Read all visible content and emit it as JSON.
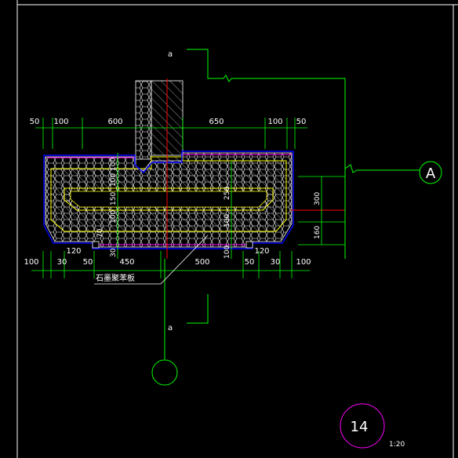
{
  "drawing": {
    "section_mark_top": "a",
    "section_mark_bottom": "a",
    "axis_label": "A",
    "detail_number": "14",
    "detail_scale": "1:20",
    "material_label": "石墨聚苯板",
    "colors": {
      "background": "#000000",
      "frame": "#ffffff",
      "dimension": "#00ff00",
      "concrete": "#ffff00",
      "insulation": "#0000ff",
      "hatch": "#ffffff",
      "axis": "#ff0000",
      "magenta": "#ff00ff",
      "leader": "#00ff00"
    }
  },
  "dims_top": [
    "50",
    "100",
    "600",
    "650",
    "100",
    "50"
  ],
  "dims_bottom": [
    "100",
    "30",
    "120",
    "50",
    "450",
    "500",
    "50",
    "120",
    "30",
    "100"
  ],
  "dims_vertical_left": [
    "100",
    "100",
    "150",
    "100",
    "70",
    "30"
  ],
  "dims_vertical_center": [
    "250",
    "100",
    "100"
  ],
  "dims_vertical_right": [
    "300",
    "160"
  ]
}
